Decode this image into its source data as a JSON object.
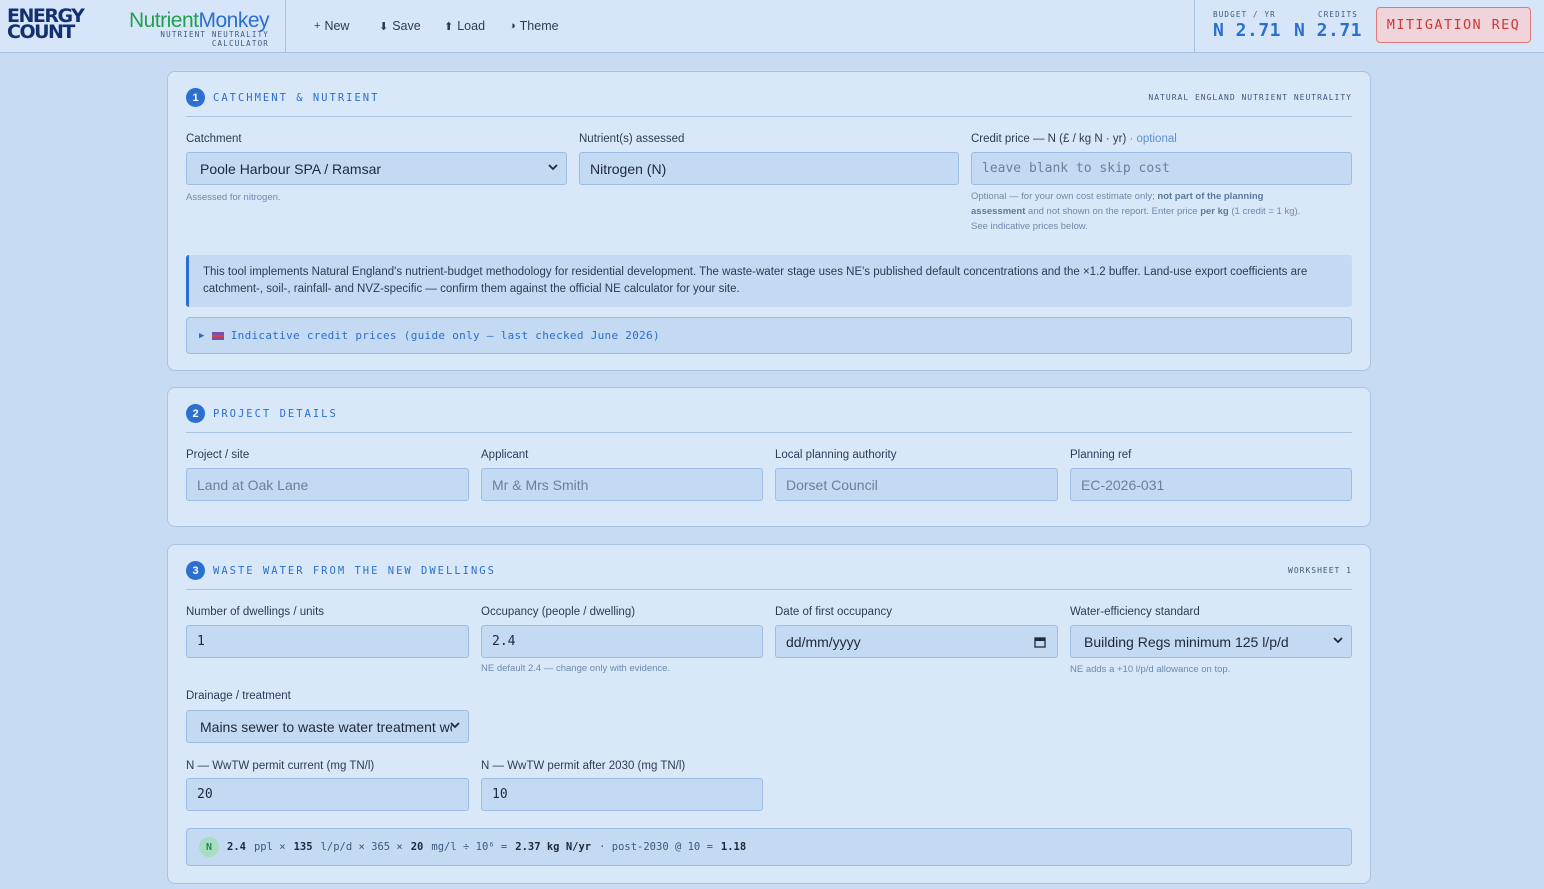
{
  "brand": {
    "energy_line1": "ENERGY",
    "energy_line2": "COUNT",
    "app_name_part1": "Nutrient",
    "app_name_part2": "Monkey",
    "tagline": "NUTRIENT NEUTRALITY CALCULATOR"
  },
  "toolbar": {
    "new_label": "New",
    "save_label": "Save",
    "load_label": "Load",
    "theme_label": "Theme"
  },
  "stats": {
    "budget_label": "BUDGET / YR",
    "budget_value": "N 2.71",
    "credits_label": "CREDITS",
    "credits_value": "N 2.71",
    "status_badge": "MITIGATION REQ"
  },
  "section1": {
    "number": "1",
    "title": "CATCHMENT & NUTRIENT",
    "tag": "NATURAL ENGLAND NUTRIENT NEUTRALITY",
    "catchment_label": "Catchment",
    "catchment_value": "Poole Harbour SPA / Ramsar",
    "catchment_hint": "Assessed for nitrogen.",
    "nutrient_label": "Nutrient(s) assessed",
    "nutrient_value": "Nitrogen (N)",
    "credit_label": "Credit price — N (£ / kg N · yr)",
    "credit_optional": "· optional",
    "credit_placeholder": "leave blank to skip cost",
    "credit_hint_1": "Optional — for your own cost estimate only;",
    "credit_hint_2": "not part of the planning",
    "credit_hint_3": "assessment",
    "credit_hint_4": "and not shown on the report. Enter price",
    "credit_hint_5": "per kg",
    "credit_hint_6": "(1 credit = 1 kg).",
    "credit_hint_7": "See indicative prices below.",
    "info_text": "This tool implements Natural England's nutrient-budget methodology for residential development. The waste-water stage uses NE's published default concentrations and the ×1.2 buffer. Land-use export coefficients are catchment-, soil-, rainfall- and NVZ-specific — confirm them against the official NE calculator for your site.",
    "prices_summary": "Indicative credit prices (guide only — last checked June 2026)"
  },
  "section2": {
    "number": "2",
    "title": "PROJECT DETAILS",
    "project_label": "Project / site",
    "project_placeholder": "Land at Oak Lane",
    "applicant_label": "Applicant",
    "applicant_placeholder": "Mr & Mrs Smith",
    "lpa_label": "Local planning authority",
    "lpa_placeholder": "Dorset Council",
    "ref_label": "Planning ref",
    "ref_placeholder": "EC-2026-031"
  },
  "section3": {
    "number": "3",
    "title": "WASTE WATER FROM THE NEW DWELLINGS",
    "tag": "WORKSHEET 1",
    "dwellings_label": "Number of dwellings / units",
    "dwellings_value": "1",
    "occupancy_label": "Occupancy (people / dwelling)",
    "occupancy_value": "2.4",
    "occupancy_hint": "NE default 2.4 — change only with evidence.",
    "date_label": "Date of first occupancy",
    "date_placeholder": "dd/mm/yyyy",
    "water_label": "Water-efficiency standard",
    "water_value": "Building Regs minimum 125 l/p/d",
    "water_hint": "NE adds a +10 l/p/d allowance on top.",
    "drainage_label": "Drainage / treatment",
    "drainage_value": "Mains sewer to waste water treatment works",
    "permit_now_label": "N — WwTW permit current (mg TN/l)",
    "permit_now_value": "20",
    "permit_2030_label": "N — WwTW permit after 2030 (mg TN/l)",
    "permit_2030_value": "10"
  },
  "formula": {
    "badge": "N",
    "people": "2.4",
    "ppl_unit": "ppl ×",
    "water": "135",
    "water_unit": "l/p/d × 365 ×",
    "conc": "20",
    "conc_unit": "mg/l ÷ 10⁶ =",
    "result": "2.37 kg N/yr",
    "post_text": "· post-2030 @ 10 =",
    "post_value": "1.18"
  },
  "colors": {
    "accent": "#2b6fd0",
    "brand_green": "#23a04f",
    "alert_red": "#c93a3a",
    "background": "#c7dcf3"
  },
  "icons": {
    "new": "plus-icon",
    "save": "download-icon",
    "load": "upload-icon",
    "theme": "half-circle-icon",
    "select": "chevron-down-icon",
    "calendar": "calendar-icon",
    "disclosure": "triangle-right-icon",
    "flag": "flag-icon"
  }
}
